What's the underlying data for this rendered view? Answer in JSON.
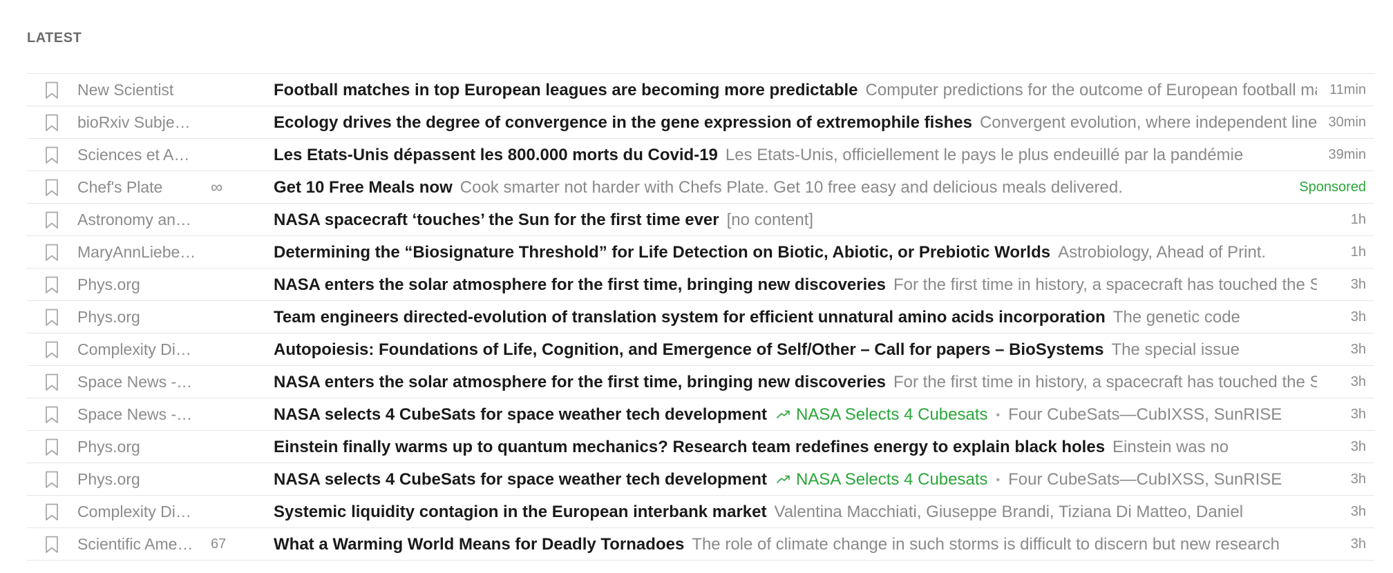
{
  "section": {
    "heading": "LATEST"
  },
  "colors": {
    "accent_green": "#2aa63a",
    "muted": "#8c8c8c",
    "title": "#1a1a1a"
  },
  "rows": [
    {
      "source": "New Scientist",
      "count": "",
      "title": "Football matches in top European leagues are becoming more predictable",
      "snippet": "Computer predictions for the outcome of European football matches",
      "time": "11min"
    },
    {
      "source": "bioRxiv Subje…",
      "count": "",
      "title": "Ecology drives the degree of convergence in the gene expression of extremophile fishes",
      "snippet": "Convergent evolution, where independent lineages",
      "time": "30min"
    },
    {
      "source": "Sciences et A…",
      "count": "",
      "title": "Les Etats-Unis dépassent les 800.000 morts du Covid-19",
      "snippet": "Les Etats-Unis, officiellement le pays le plus endeuillé par la pandémie",
      "time": "39min"
    },
    {
      "source": "Chef's Plate",
      "count": "∞",
      "title": "Get 10 Free Meals now",
      "snippet": "Cook smarter not harder with Chefs Plate. Get 10 free easy and delicious meals delivered.",
      "time": "Sponsored"
    },
    {
      "source": "Astronomy an…",
      "count": "",
      "title": "NASA spacecraft ‘touches’ the Sun for the first time ever",
      "snippet": "[no content]",
      "time": "1h"
    },
    {
      "source": "MaryAnnLiebe…",
      "count": "",
      "title": "Determining the “Biosignature Threshold” for Life Detection on Biotic, Abiotic, or Prebiotic Worlds",
      "snippet": "Astrobiology, Ahead of Print.",
      "time": "1h"
    },
    {
      "source": "Phys.org",
      "count": "",
      "title": "NASA enters the solar atmosphere for the first time, bringing new discoveries",
      "snippet": "For the first time in history, a spacecraft has touched the Sun.",
      "time": "3h"
    },
    {
      "source": "Phys.org",
      "count": "",
      "title": "Team engineers directed-evolution of translation system for efficient unnatural amino acids incorporation",
      "snippet": "The genetic code",
      "time": "3h"
    },
    {
      "source": "Complexity Di…",
      "count": "",
      "title": "Autopoiesis: Foundations of Life, Cognition, and Emergence of Self/Other – Call for papers – BioSystems",
      "snippet": "The special issue",
      "time": "3h"
    },
    {
      "source": "Space News -…",
      "count": "",
      "title": "NASA enters the solar atmosphere for the first time, bringing new discoveries",
      "snippet": "For the first time in history, a spacecraft has touched the Sun.",
      "time": "3h"
    },
    {
      "source": "Space News -…",
      "count": "",
      "title": "NASA selects 4 CubeSats for space weather tech development",
      "trend": "NASA Selects 4 Cubesats",
      "snippet": "Four CubeSats—CubIXSS, SunRISE",
      "time": "3h"
    },
    {
      "source": "Phys.org",
      "count": "",
      "title": "Einstein finally warms up to quantum mechanics? Research team redefines energy to explain black holes",
      "snippet": "Einstein was no",
      "time": "3h"
    },
    {
      "source": "Phys.org",
      "count": "",
      "title": "NASA selects 4 CubeSats for space weather tech development",
      "trend": "NASA Selects 4 Cubesats",
      "snippet": "Four CubeSats—CubIXSS, SunRISE",
      "time": "3h"
    },
    {
      "source": "Complexity Di…",
      "count": "",
      "title": "Systemic liquidity contagion in the European interbank market",
      "snippet": "Valentina Macchiati, Giuseppe Brandi, Tiziana Di Matteo, Daniel",
      "time": "3h"
    },
    {
      "source": "Scientific Ame…",
      "count": "67",
      "title": "What a Warming World Means for Deadly Tornadoes",
      "snippet": "The role of climate change in such storms is difficult to discern but new research",
      "time": "3h"
    }
  ]
}
